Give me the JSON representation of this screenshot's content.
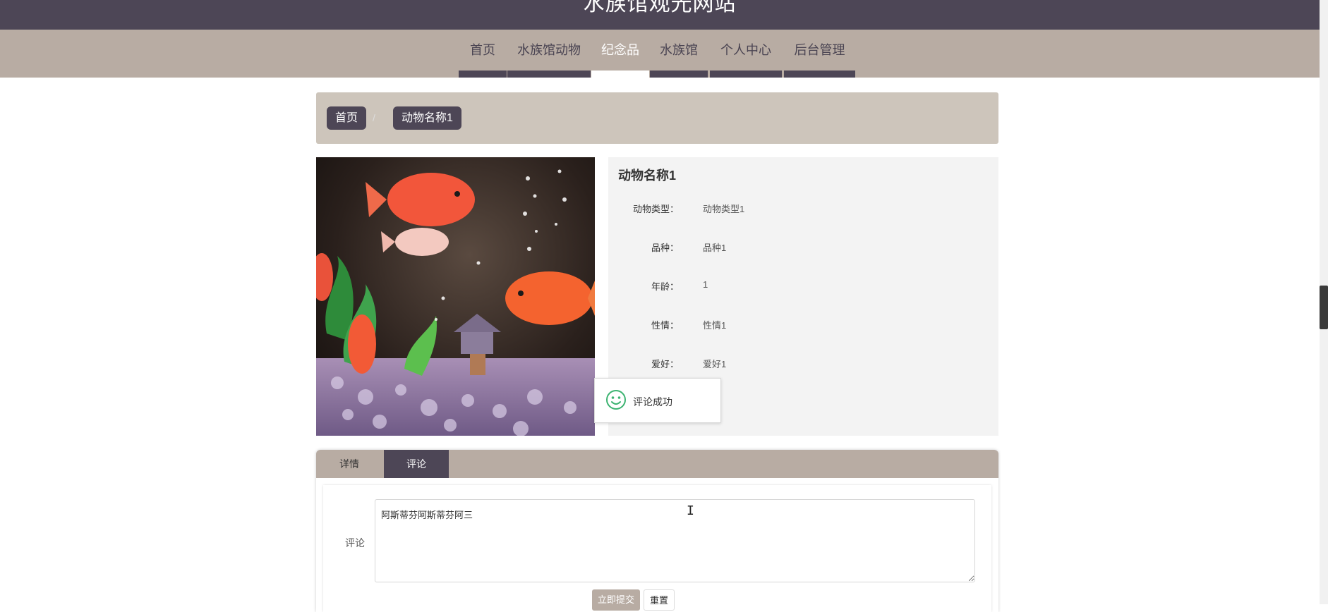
{
  "site": {
    "title": "水族馆观光网站"
  },
  "nav": {
    "items": [
      {
        "label": "首页"
      },
      {
        "label": "水族馆动物"
      },
      {
        "label": "纪念品"
      },
      {
        "label": "水族馆"
      },
      {
        "label": "个人中心"
      },
      {
        "label": "后台管理"
      }
    ],
    "active": "纪念品"
  },
  "breadcrumb": {
    "home": "首页",
    "separator": "/",
    "current": "动物名称1"
  },
  "detail": {
    "name": "动物名称1",
    "fields": [
      {
        "label": "动物类型：",
        "value": "动物类型1"
      },
      {
        "label": "品种：",
        "value": "品种1"
      },
      {
        "label": "年龄：",
        "value": "1"
      },
      {
        "label": "性情：",
        "value": "性情1"
      },
      {
        "label": "爱好：",
        "value": "爱好1"
      }
    ]
  },
  "toast": {
    "message": "评论成功",
    "icon": "smile-icon"
  },
  "tabs": {
    "items": [
      {
        "label": "详情"
      },
      {
        "label": "评论"
      }
    ],
    "active": "评论"
  },
  "comment_form": {
    "label": "评论",
    "value": "阿斯蒂芬阿斯蒂芬阿三",
    "submit_label": "立即提交",
    "reset_label": "重置"
  },
  "colors": {
    "header_bg": "#4d4656",
    "nav_bg": "#b8aca3",
    "breadcrumb_bg": "#cdc5bb",
    "toast_icon": "#3cb371"
  }
}
